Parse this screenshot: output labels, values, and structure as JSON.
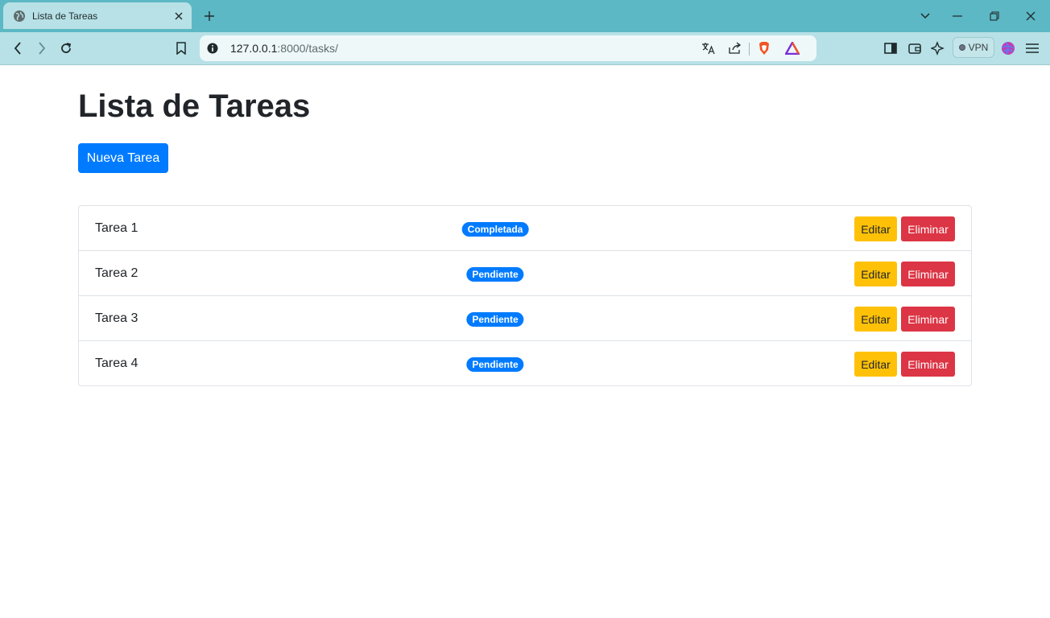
{
  "browser": {
    "tab_title": "Lista de Tareas",
    "url_host": "127.0.0.1",
    "url_rest": ":8000/tasks/",
    "vpn_label": "VPN"
  },
  "page": {
    "title": "Lista de Tareas",
    "new_task_label": "Nueva Tarea"
  },
  "tasks": [
    {
      "name": "Tarea 1",
      "status": "Completada",
      "edit_label": "Editar",
      "delete_label": "Eliminar"
    },
    {
      "name": "Tarea 2",
      "status": "Pendiente",
      "edit_label": "Editar",
      "delete_label": "Eliminar"
    },
    {
      "name": "Tarea 3",
      "status": "Pendiente",
      "edit_label": "Editar",
      "delete_label": "Eliminar"
    },
    {
      "name": "Tarea 4",
      "status": "Pendiente",
      "edit_label": "Editar",
      "delete_label": "Eliminar"
    }
  ],
  "colors": {
    "primary": "#007bff",
    "warning": "#ffc107",
    "danger": "#dc3545",
    "chrome_tabbar": "#5cb8c4",
    "chrome_toolbar": "#b7e1e6"
  },
  "icons": [
    "globe-icon",
    "close-icon",
    "plus-icon",
    "chevron-down-icon",
    "minimize-icon",
    "restore-icon",
    "back-icon",
    "forward-icon",
    "reload-icon",
    "bookmark-icon",
    "info-icon",
    "translate-icon",
    "share-icon",
    "brave-shield-icon",
    "brave-rewards-icon",
    "sidebar-icon",
    "wallet-icon",
    "leo-ai-icon",
    "profile-icon",
    "menu-icon"
  ]
}
